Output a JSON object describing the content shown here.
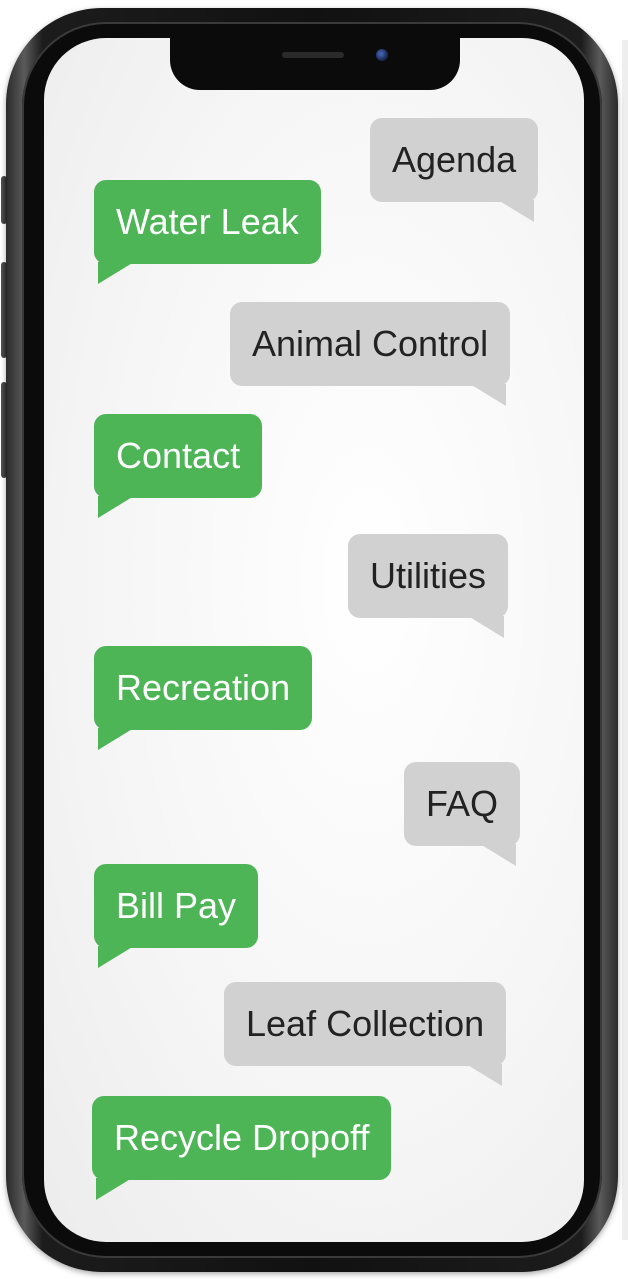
{
  "phone": {
    "bubbles": [
      {
        "label": "Agenda",
        "style": "grey"
      },
      {
        "label": "Water Leak",
        "style": "green"
      },
      {
        "label": "Animal Control",
        "style": "grey"
      },
      {
        "label": "Contact",
        "style": "green"
      },
      {
        "label": "Utilities",
        "style": "grey"
      },
      {
        "label": "Recreation",
        "style": "green"
      },
      {
        "label": "FAQ",
        "style": "grey"
      },
      {
        "label": "Bill Pay",
        "style": "green"
      },
      {
        "label": "Leaf Collection",
        "style": "grey"
      },
      {
        "label": "Recycle Dropoff",
        "style": "green"
      }
    ]
  },
  "colors": {
    "green_bubble": "#4db556",
    "grey_bubble": "#d1d1d1",
    "phone_frame": "#111111"
  }
}
